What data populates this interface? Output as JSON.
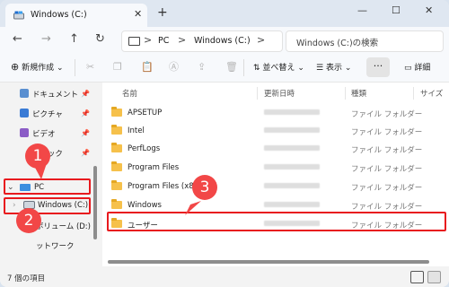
{
  "window": {
    "tab_title": "Windows (C:)",
    "close_tab": "✕",
    "new_tab": "+",
    "minimize": "—",
    "maximize": "☐",
    "close": "✕"
  },
  "address": {
    "segments": [
      "PC",
      "Windows (C:)"
    ],
    "separator": ">",
    "search_placeholder": "Windows (C:)の検索"
  },
  "nav": {
    "back": "←",
    "forward": "→",
    "up": "↑",
    "refresh": "↻"
  },
  "toolbar": {
    "new_label": "新規作成",
    "new_caret": "⌄",
    "sort_label": "並べ替え",
    "view_label": "表示",
    "more": "···",
    "details_label": "詳細"
  },
  "sidebar": {
    "items": [
      {
        "label": "ドキュメント",
        "icon": "documents-icon",
        "pinned": true
      },
      {
        "label": "ピクチャ",
        "icon": "pictures-icon",
        "pinned": true
      },
      {
        "label": "ビデオ",
        "icon": "videos-icon",
        "pinned": true
      },
      {
        "label": "ージック",
        "icon": "music-icon",
        "pinned": true
      },
      {
        "label": "PC",
        "icon": "pc-icon",
        "expanded": true
      },
      {
        "label": "Windows (C:)",
        "icon": "drive-icon"
      },
      {
        "label": "ボリューム (D:)",
        "icon": "drive-icon"
      },
      {
        "label": "ットワーク",
        "icon": "network-icon"
      }
    ]
  },
  "columns": {
    "name": "名前",
    "modified": "更新日時",
    "type": "種類",
    "size": "サイズ"
  },
  "files": [
    {
      "name": "APSETUP",
      "type": "ファイル フォルダー"
    },
    {
      "name": "Intel",
      "type": "ファイル フォルダー"
    },
    {
      "name": "PerfLogs",
      "type": "ファイル フォルダー"
    },
    {
      "name": "Program Files",
      "type": "ファイル フォルダー"
    },
    {
      "name": "Program Files (x86)",
      "type": "ファイル フォルダー"
    },
    {
      "name": "Windows",
      "type": "ファイル フォルダー"
    },
    {
      "name": "ユーザー",
      "type": "ファイル フォルダー"
    }
  ],
  "status": {
    "count_text": "7 個の項目"
  },
  "annotations": {
    "callout_1": "1",
    "callout_2": "2",
    "callout_3": "3",
    "color": "#e8191e"
  }
}
